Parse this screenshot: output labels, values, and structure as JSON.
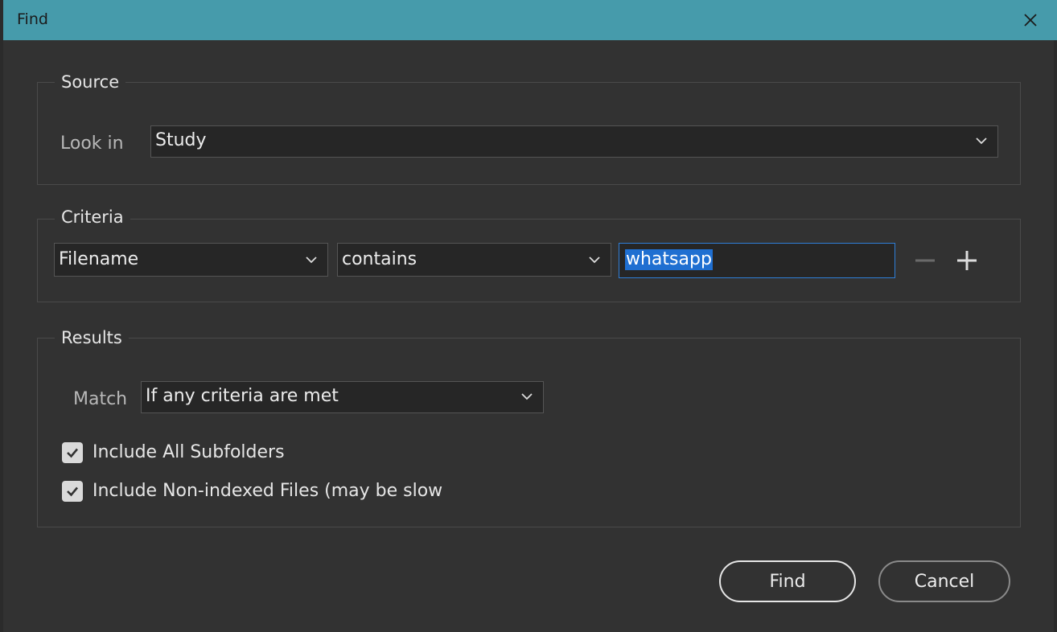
{
  "window": {
    "title": "Find",
    "close_icon": "close-icon"
  },
  "source": {
    "legend": "Source",
    "look_in_label": "Look in",
    "look_in_value": "Study"
  },
  "criteria": {
    "legend": "Criteria",
    "field_value": "Filename",
    "operator_value": "contains",
    "text_value": "whatsapp",
    "remove_icon": "minus-icon",
    "add_icon": "plus-icon"
  },
  "results": {
    "legend": "Results",
    "match_label": "Match",
    "match_value": "If any criteria are met",
    "include_subfolders_label": "Include All Subfolders",
    "include_subfolders_checked": true,
    "include_nonindexed_label": "Include Non-indexed Files (may be slow",
    "include_nonindexed_checked": true
  },
  "buttons": {
    "find_label": "Find",
    "cancel_label": "Cancel"
  },
  "colors": {
    "titlebar": "#469bab",
    "background": "#323232",
    "selection": "#1f6fd1",
    "focus_border": "#2f7fd8"
  }
}
